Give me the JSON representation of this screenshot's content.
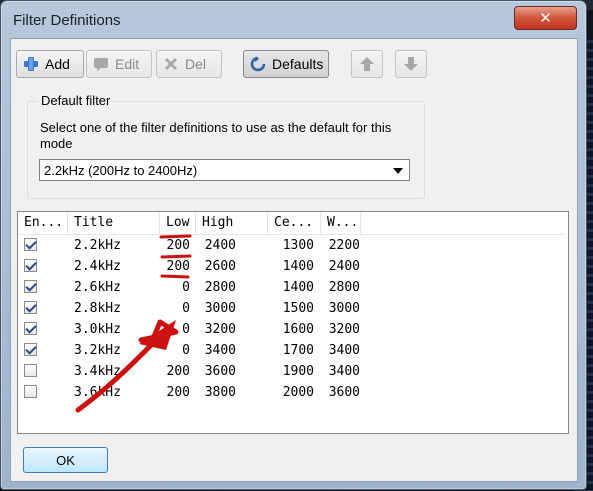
{
  "window": {
    "title": "Filter Definitions",
    "close_glyph": "✕"
  },
  "toolbar": {
    "add_label": "Add",
    "edit_label": "Edit",
    "del_label": "Del",
    "defaults_label": "Defaults",
    "icons": {
      "add": "plus-icon",
      "edit": "comment-icon",
      "del": "cross-icon",
      "defaults": "reset-icon",
      "up": "arrow-up-icon",
      "down": "arrow-down-icon"
    }
  },
  "default_filter": {
    "group_title": "Default filter",
    "description": "Select one of the filter definitions to use as the default for this mode",
    "selected": "2.2kHz (200Hz to 2400Hz)"
  },
  "table": {
    "headers": [
      "En...",
      "Title",
      "Low",
      "High",
      "Ce...",
      "W..."
    ],
    "rows": [
      {
        "enabled": true,
        "title": "2.2kHz",
        "low": "200",
        "high": "2400",
        "center": "1300",
        "width": "2200"
      },
      {
        "enabled": true,
        "title": "2.4kHz",
        "low": "200",
        "high": "2600",
        "center": "1400",
        "width": "2400"
      },
      {
        "enabled": true,
        "title": "2.6kHz",
        "low": "0",
        "high": "2800",
        "center": "1400",
        "width": "2800"
      },
      {
        "enabled": true,
        "title": "2.8kHz",
        "low": "0",
        "high": "3000",
        "center": "1500",
        "width": "3000"
      },
      {
        "enabled": true,
        "title": "3.0kHz",
        "low": "0",
        "high": "3200",
        "center": "1600",
        "width": "3200"
      },
      {
        "enabled": true,
        "title": "3.2kHz",
        "low": "0",
        "high": "3400",
        "center": "1700",
        "width": "3400"
      },
      {
        "enabled": false,
        "title": "3.4kHz",
        "low": "200",
        "high": "3600",
        "center": "1900",
        "width": "3400"
      },
      {
        "enabled": false,
        "title": "3.6kHz",
        "low": "200",
        "high": "3800",
        "center": "2000",
        "width": "3600"
      }
    ]
  },
  "footer": {
    "ok_label": "OK"
  },
  "colors": {
    "annotation_red": "#cc1111",
    "accent_blue": "#3c7fb1"
  }
}
